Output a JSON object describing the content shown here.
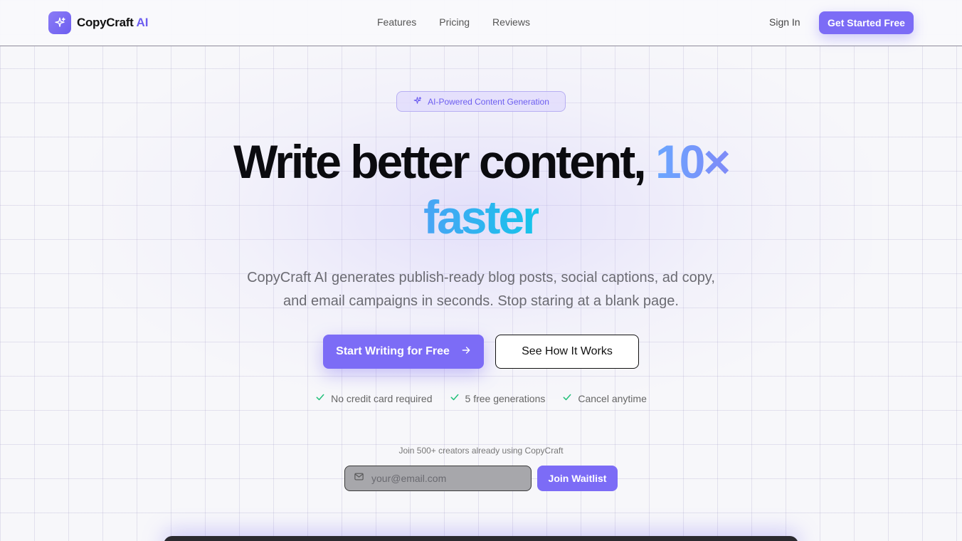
{
  "brand": {
    "name": "CopyCraft",
    "suffix": "AI",
    "accent": "#7c6cf6"
  },
  "nav": {
    "links": [
      "Features",
      "Pricing",
      "Reviews"
    ],
    "sign_in": "Sign In",
    "cta": "Get Started Free"
  },
  "hero": {
    "badge": "AI-Powered Content Generation",
    "headline_plain": "Write better content, ",
    "headline_accent_1": "10×",
    "headline_accent_2": "faster",
    "subtitle": "CopyCraft AI generates publish-ready blog posts, social captions, ad copy, and email campaigns in seconds. Stop staring at a blank page.",
    "primary_cta": "Start Writing for Free",
    "secondary_cta": "See How It Works",
    "checks": [
      "No credit card required",
      "5 free generations",
      "Cancel anytime"
    ]
  },
  "waitlist": {
    "caption": "Join 500+ creators already using CopyCraft",
    "placeholder": "your@email.com",
    "button": "Join Waitlist"
  },
  "icons": {
    "logo": "sparkles-icon",
    "badge": "sparkles-icon",
    "arrow": "arrow-right-icon",
    "check": "check-icon",
    "mail": "mail-icon"
  },
  "colors": {
    "check": "#22c07a",
    "headline_blue": "#7f8bf8",
    "headline_cyan": "#14c4ea"
  }
}
